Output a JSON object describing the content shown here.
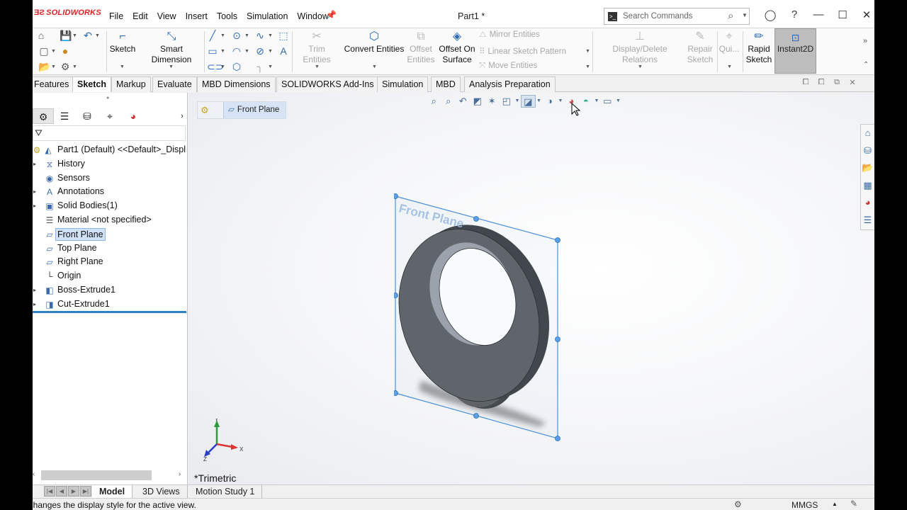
{
  "app": {
    "brand": "SOLIDWORKS",
    "brand_prefix": "3DS",
    "document_title": "Part1 *"
  },
  "menu": [
    "File",
    "Edit",
    "View",
    "Insert",
    "Tools",
    "Simulation",
    "Window"
  ],
  "search": {
    "placeholder": "Search Commands"
  },
  "commands": {
    "sketch": "Sketch",
    "smart_dimension": "Smart Dimension",
    "trim_entities": "Trim Entities",
    "convert_entities": "Convert Entities",
    "offset_entities_1": "Offset",
    "offset_entities_2": "Entities",
    "offset_on_surface_1": "Offset On",
    "offset_on_surface_2": "Surface",
    "mirror_entities": "Mirror Entities",
    "linear_sketch_pattern": "Linear Sketch Pattern",
    "move_entities": "Move Entities",
    "display_delete_relations": "Display/Delete Relations",
    "repair_sketch_1": "Repair",
    "repair_sketch_2": "Sketch",
    "quick_snaps": "Qui...",
    "rapid_sketch_1": "Rapid",
    "rapid_sketch_2": "Sketch",
    "instant2d": "Instant2D"
  },
  "tabs": [
    "Features",
    "Sketch",
    "Markup",
    "Evaluate",
    "MBD Dimensions",
    "SOLIDWORKS Add-Ins",
    "Simulation",
    "MBD",
    "Analysis Preparation"
  ],
  "active_tab": "Sketch",
  "tree": {
    "root": "Part1 (Default) <<Default>_Displ",
    "items": [
      {
        "label": "History",
        "expandable": true,
        "icon": "history-icon"
      },
      {
        "label": "Sensors",
        "expandable": false,
        "icon": "sensors-icon"
      },
      {
        "label": "Annotations",
        "expandable": true,
        "icon": "annotations-icon"
      },
      {
        "label": "Solid Bodies(1)",
        "expandable": true,
        "icon": "solid-bodies-icon"
      },
      {
        "label": "Material <not specified>",
        "expandable": false,
        "icon": "material-icon"
      },
      {
        "label": "Front Plane",
        "expandable": false,
        "icon": "plane-icon",
        "selected": true
      },
      {
        "label": "Top Plane",
        "expandable": false,
        "icon": "plane-icon"
      },
      {
        "label": "Right Plane",
        "expandable": false,
        "icon": "plane-icon"
      },
      {
        "label": "Origin",
        "expandable": false,
        "icon": "origin-icon"
      },
      {
        "label": "Boss-Extrude1",
        "expandable": true,
        "icon": "boss-extrude-icon"
      },
      {
        "label": "Cut-Extrude1",
        "expandable": true,
        "icon": "cut-extrude-icon"
      }
    ]
  },
  "breadcrumb": {
    "item": "Front Plane"
  },
  "viewport": {
    "plane_label": "Front Plane",
    "view_name": "*Trimetric",
    "triad": {
      "x": "X",
      "y": "Y",
      "z": "Z"
    }
  },
  "bottom_tabs": [
    "Model",
    "3D Views",
    "Motion Study 1"
  ],
  "active_bottom_tab": "Model",
  "status": {
    "message": "Changes the display style for the active view.",
    "units": "MMGS"
  },
  "colors": {
    "accent": "#2d6ab8",
    "brand": "#d22222",
    "selection": "#cfe2f7",
    "plane_outline": "#4a90d9",
    "part": "#55585d"
  }
}
